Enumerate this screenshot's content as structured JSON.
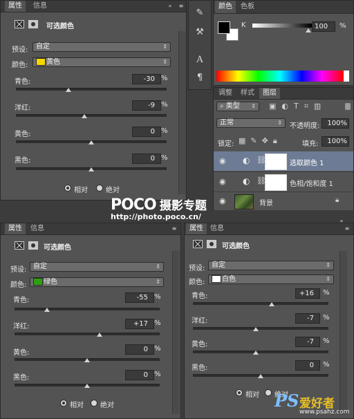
{
  "panel1": {
    "tabs": [
      "属性",
      "信息"
    ],
    "title": "可选颜色",
    "preset_label": "预设:",
    "preset_value": "自定",
    "color_label": "颜色:",
    "color_value": "黄色",
    "color_swatch": "#f5d800",
    "sliders": [
      {
        "label": "青色:",
        "value": "-30",
        "pct": "%",
        "level": -30
      },
      {
        "label": "洋红:",
        "value": "-9",
        "pct": "%",
        "level": -9
      },
      {
        "label": "黄色:",
        "value": "0",
        "pct": "%",
        "level": 0
      },
      {
        "label": "黑色:",
        "value": "0",
        "pct": "%",
        "level": 0
      }
    ],
    "radio_relative": "相对",
    "radio_absolute": "绝对",
    "selected": "relative"
  },
  "color_panel": {
    "tabs": [
      "颜色",
      "色板"
    ],
    "channel": "K",
    "value": "100",
    "pct": "%"
  },
  "layers_panel": {
    "tabs": [
      "调整",
      "样式",
      "图层"
    ],
    "filter_kind": "类型",
    "blend_mode": "正常",
    "opacity_label": "不透明度:",
    "opacity_value": "100%",
    "lock_label": "锁定:",
    "fill_label": "填充:",
    "fill_value": "100%",
    "layers": [
      {
        "name": "选取颜色 1",
        "selected": true
      },
      {
        "name": "色相/饱和度 1",
        "selected": false
      },
      {
        "name": "背景",
        "selected": false
      }
    ]
  },
  "watermark": {
    "brand": "POCO",
    "brand_cn": "摄影专题",
    "url": "http://photo.poco.cn/"
  },
  "panel2": {
    "tabs": [
      "属性",
      "信息"
    ],
    "title": "可选颜色",
    "preset_label": "预设:",
    "preset_value": "自定",
    "color_label": "颜色:",
    "color_value": "绿色",
    "color_swatch": "#2ea010",
    "sliders": [
      {
        "label": "青色:",
        "value": "-55",
        "pct": "%",
        "level": -55
      },
      {
        "label": "洋红:",
        "value": "+17",
        "pct": "%",
        "level": 17
      },
      {
        "label": "黄色:",
        "value": "0",
        "pct": "%",
        "level": 0
      },
      {
        "label": "黑色:",
        "value": "0",
        "pct": "%",
        "level": 0
      }
    ],
    "radio_relative": "相对",
    "radio_absolute": "绝对",
    "selected": "relative"
  },
  "panel3": {
    "tabs": [
      "属性",
      "信息"
    ],
    "title": "可选颜色",
    "preset_label": "预设:",
    "preset_value": "自定",
    "color_label": "颜色:",
    "color_value": "白色",
    "color_swatch": "#ffffff",
    "sliders": [
      {
        "label": "青色:",
        "value": "+16",
        "pct": "%",
        "level": 16
      },
      {
        "label": "洋红:",
        "value": "-7",
        "pct": "%",
        "level": -7
      },
      {
        "label": "黄色:",
        "value": "-7",
        "pct": "%",
        "level": -7
      },
      {
        "label": "黑色:",
        "value": "0",
        "pct": "%",
        "level": 0
      }
    ],
    "radio_relative": "相对",
    "radio_absolute": "绝对",
    "selected": "relative"
  },
  "ps_logo": {
    "text": "PS",
    "text_cn": "爱好者",
    "url": "www.psahz.com"
  }
}
